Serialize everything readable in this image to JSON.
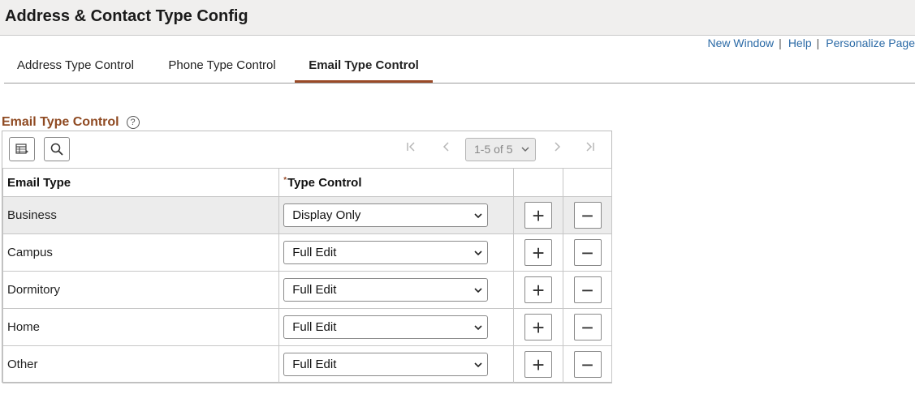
{
  "page": {
    "title": "Address & Contact Type Config"
  },
  "links": {
    "new_window": "New Window",
    "help": "Help",
    "personalize": "Personalize Page",
    "separator": "|"
  },
  "tabs": [
    {
      "label": "Address Type Control",
      "active": false
    },
    {
      "label": "Phone Type Control",
      "active": false
    },
    {
      "label": "Email Type Control",
      "active": true
    }
  ],
  "section": {
    "title": "Email Type Control",
    "help_glyph": "?"
  },
  "grid": {
    "pager": {
      "range": "1-5 of 5"
    },
    "columns": {
      "email_type": "Email Type",
      "type_control": "Type Control",
      "required_mark": "*"
    },
    "rows": [
      {
        "email_type": "Business",
        "type_control": "Display Only"
      },
      {
        "email_type": "Campus",
        "type_control": "Full Edit"
      },
      {
        "email_type": "Dormitory",
        "type_control": "Full Edit"
      },
      {
        "email_type": "Home",
        "type_control": "Full Edit"
      },
      {
        "email_type": "Other",
        "type_control": "Full Edit"
      }
    ],
    "add_glyph": "+",
    "delete_glyph": "−"
  },
  "colors": {
    "accent": "#9a4a27",
    "link": "#2b6aa6",
    "title_bg": "#f0efee"
  }
}
